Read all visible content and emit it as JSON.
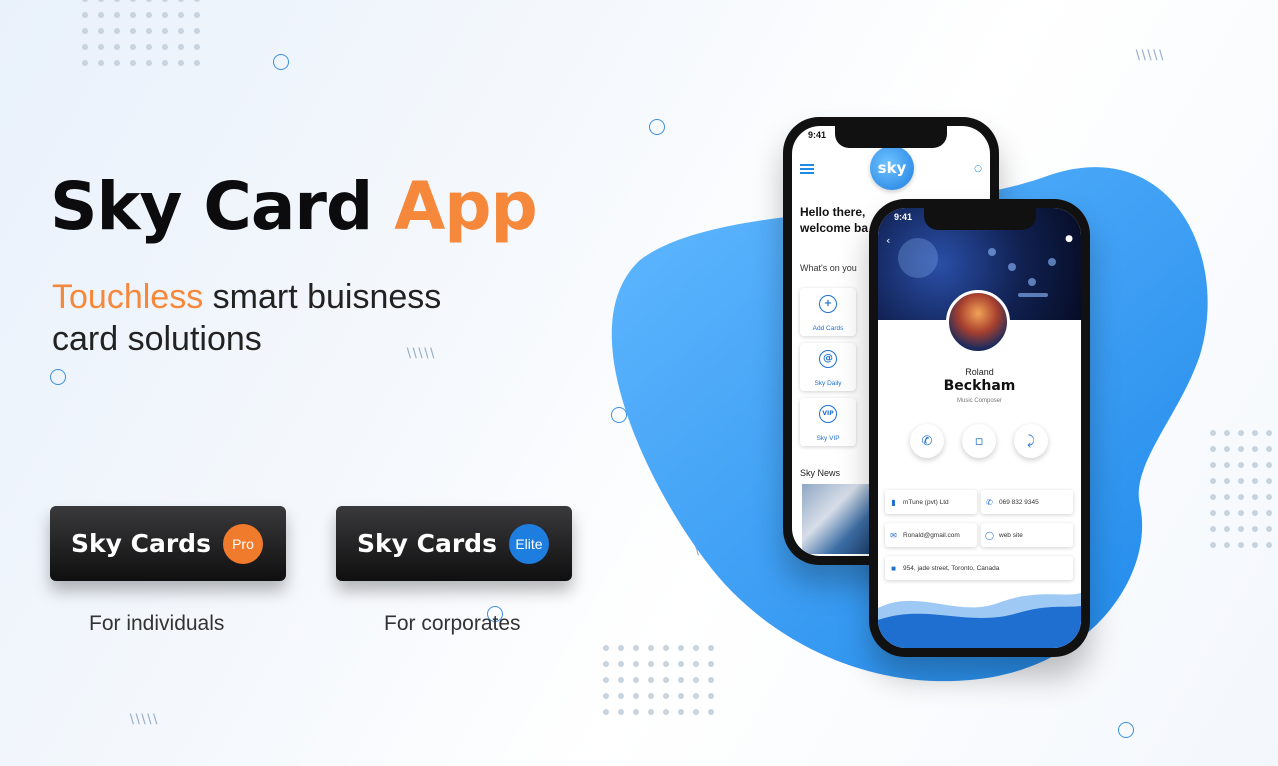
{
  "headline": {
    "part1": "Sky Card",
    "part2": "App"
  },
  "tagline": {
    "accent": "Touchless",
    "rest": " smart buisness",
    "line2": "card solutions"
  },
  "plans": [
    {
      "label": "Sky Cards",
      "badge": "Pro",
      "badge_color": "#f07b2c",
      "caption": "For individuals"
    },
    {
      "label": "Sky Cards",
      "badge": "Elite",
      "badge_color": "#1e7ee0",
      "caption": "For corporates"
    }
  ],
  "colors": {
    "accent_orange": "#f5883a",
    "brand_blue": "#1e8ae6",
    "blob_blue": "#2f98f3"
  },
  "home_screen": {
    "time": "9:41",
    "logo_text": "sky",
    "greeting_line1": "Hello there,",
    "greeting_line2": "welcome ba",
    "section_title": "What's on you",
    "tiles": [
      {
        "icon": "add-card-icon",
        "label": "Add Cards"
      },
      {
        "icon": "mail-icon",
        "label": "Sky Daily"
      },
      {
        "icon": "vip-icon",
        "label": "Sky VIP"
      }
    ],
    "news_title": "Sky News"
  },
  "profile_screen": {
    "time": "9:41",
    "first_name": "Roland",
    "last_name": "Beckham",
    "role": "Music Composer",
    "actions": [
      "phone-icon",
      "chat-icon",
      "share-icon"
    ],
    "info": {
      "company": "mTune (pvt) Ltd",
      "phone": "069 832 9345",
      "email": "Ronald@gmail.com",
      "website": "web site",
      "address": "954, jade street, Toronto, Canada"
    }
  }
}
